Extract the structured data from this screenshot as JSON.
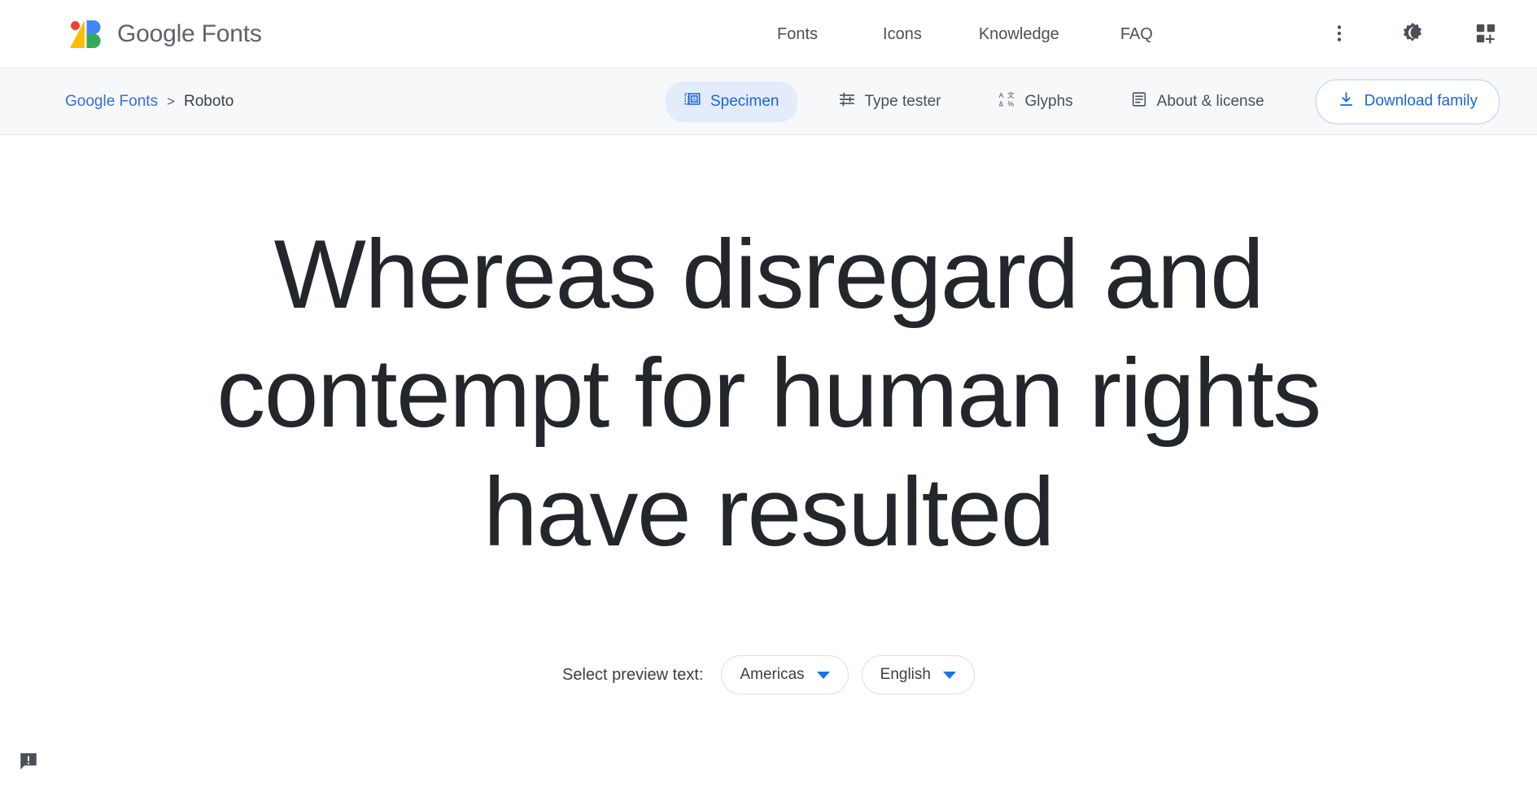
{
  "header": {
    "brand_name": "Google Fonts",
    "logo_icon": "google-fonts-logo",
    "nav": [
      {
        "label": "Fonts",
        "name": "fonts"
      },
      {
        "label": "Icons",
        "name": "icons"
      },
      {
        "label": "Knowledge",
        "name": "knowledge"
      },
      {
        "label": "FAQ",
        "name": "faq"
      }
    ],
    "icons": [
      {
        "name": "more-vert-icon",
        "label": "More options"
      },
      {
        "name": "dark-mode-icon",
        "label": "Dark mode"
      },
      {
        "name": "add-to-collection-icon",
        "label": "Add to collection"
      }
    ]
  },
  "subnav": {
    "breadcrumb": {
      "root": "Google Fonts",
      "separator": ">",
      "current": "Roboto"
    },
    "tabs": [
      {
        "label": "Specimen",
        "icon": "specimen-icon",
        "active": true
      },
      {
        "label": "Type tester",
        "icon": "tune-icon",
        "active": false
      },
      {
        "label": "Glyphs",
        "icon": "glyphs-icon",
        "active": false
      },
      {
        "label": "About & license",
        "icon": "article-icon",
        "active": false
      }
    ],
    "download_button": {
      "label": "Download family",
      "icon": "download-icon"
    }
  },
  "main": {
    "specimen_lines": [
      "Whereas disregard and",
      "contempt for human rights",
      "have resulted"
    ],
    "specimen_text": "Whereas disregard and contempt for human rights have resulted",
    "preview_controls": {
      "label": "Select preview text:",
      "region_select": {
        "value": "Americas",
        "icon": "chevron-down-icon"
      },
      "language_select": {
        "value": "English",
        "icon": "chevron-down-icon"
      }
    },
    "feedback": {
      "icon": "feedback-icon",
      "label": "Send feedback"
    }
  },
  "colors": {
    "accent_blue": "#1a65d8",
    "link_blue": "#3b6fd4",
    "active_tab_bg": "#e4ecfb",
    "subnav_bg": "#f6f8fa",
    "text_dark": "#23262a",
    "text_gray": "#4b5056"
  }
}
